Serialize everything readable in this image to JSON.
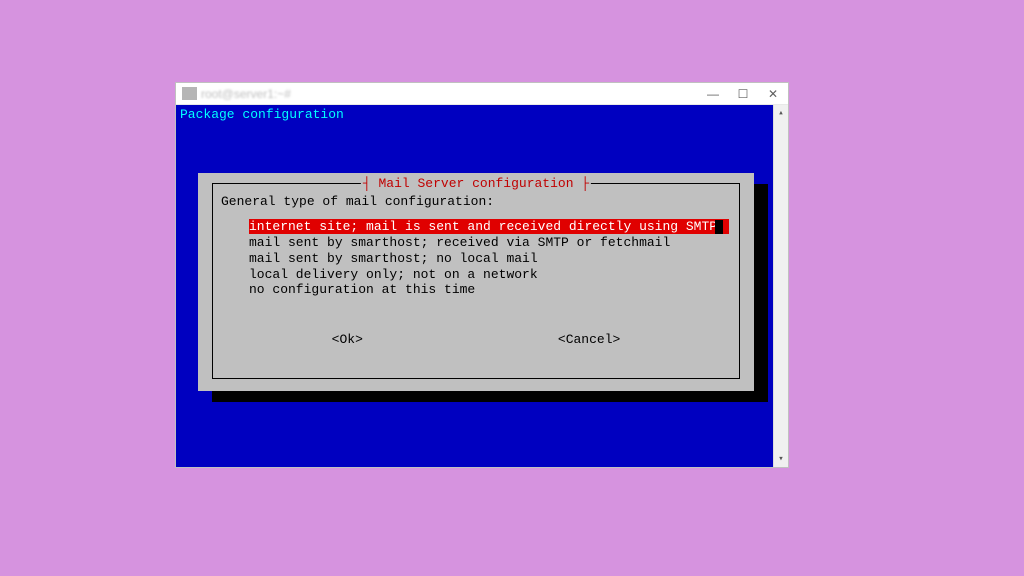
{
  "window": {
    "title": "root@server1:~#",
    "buttons": {
      "minimize": "—",
      "maximize": "☐",
      "close": "✕"
    }
  },
  "terminal": {
    "header": "Package configuration"
  },
  "dialog": {
    "title": "┤ Mail Server configuration ├",
    "prompt": "General type of mail configuration:",
    "options": [
      "internet site; mail is sent and received directly using SMTP",
      "mail sent by smarthost; received via SMTP or fetchmail",
      "mail sent by smarthost; no local mail",
      "local delivery only; not on a network",
      "no configuration at this time"
    ],
    "selected_index": 0,
    "ok": "<Ok>",
    "cancel": "<Cancel>"
  },
  "scrollbar": {
    "up": "▴",
    "down": "▾"
  }
}
